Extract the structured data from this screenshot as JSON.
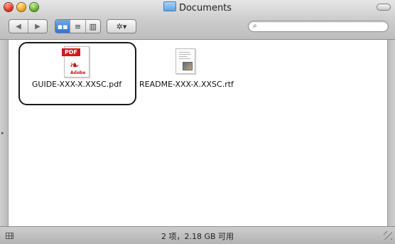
{
  "window": {
    "title": "Documents",
    "search": {
      "value": "",
      "placeholder": "",
      "icon": "search-icon"
    },
    "toolbar": {
      "back_label": "◀",
      "forward_label": "▶",
      "view_icons_label": "▪▪",
      "view_list_label": "≡",
      "view_columns_label": "▥",
      "action_label": "✲▾"
    }
  },
  "files": [
    {
      "name": "GUIDE-XXX-X.XXSC.pdf",
      "type": "pdf",
      "badge": "PDF",
      "brand": "Adobe",
      "selected": true
    },
    {
      "name": "README-XXX-X.XXSC.rtf",
      "type": "rtf"
    }
  ],
  "status": {
    "text": "2 项，2.18 GB 可用"
  }
}
